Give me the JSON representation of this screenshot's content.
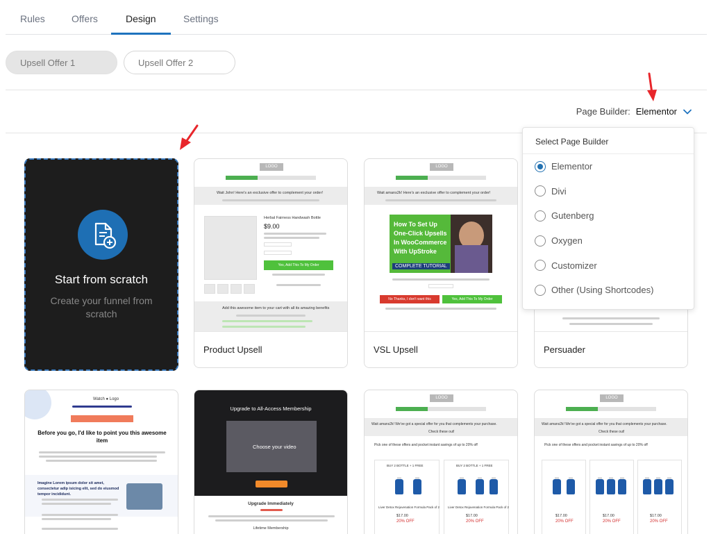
{
  "tabs": [
    {
      "label": "Rules"
    },
    {
      "label": "Offers"
    },
    {
      "label": "Design"
    },
    {
      "label": "Settings"
    }
  ],
  "offers": [
    {
      "label": "Upsell Offer 1"
    },
    {
      "label": "Upsell Offer 2"
    }
  ],
  "page_builder": {
    "label": "Page Builder:",
    "value": "Elementor"
  },
  "dropdown": {
    "header": "Select Page Builder",
    "options": [
      {
        "label": "Elementor",
        "checked": true
      },
      {
        "label": "Divi",
        "checked": false
      },
      {
        "label": "Gutenberg",
        "checked": false
      },
      {
        "label": "Oxygen",
        "checked": false
      },
      {
        "label": "Customizer",
        "checked": false
      },
      {
        "label": "Other (Using Shortcodes)",
        "checked": false
      }
    ]
  },
  "scratch": {
    "title": "Start from scratch",
    "subtitle": "Create your funnel from scratch"
  },
  "templates": [
    {
      "name": "Product Upsell"
    },
    {
      "name": "VSL Upsell"
    },
    {
      "name": "Persuader"
    }
  ],
  "thumbs": {
    "logo": "LOGO",
    "wait_john": "Wait John! Here's an exclusive offer to complement your order!",
    "wait_aman": "Wait amans2k! Here's an exclusive offer to complement your order!",
    "wait_aman2": "Wait amans2k! We've got a special offer for you that complements your purchase.",
    "vsl_title": "How To Set Up One-Click Upsells In WooCommerce With UpStroke",
    "vsl_tag": "COMPLETE TUTORIAL",
    "product_title": "Herbal Fairness Handwash Bottle",
    "product_price": "$9.00",
    "add_btn": "Yes, Add This To My Order",
    "no_btn": "No Thanks, I don't want this",
    "bundle_title": "Add this awesome item to your cart with all its amazing benefits",
    "before_title": "Before you go, I'd like to point you this awesome item",
    "before_sub": "Imagine Lorem ipsum dolor sit amet, consectetur adip isicing elit, sed do eiusmod tempor incididunt.",
    "membership_title": "Upgrade to All-Access Membership",
    "membership_btn": "Upgrade Now",
    "membership_sub": "Upgrade Immediately",
    "membership_foot": "Lifetime Membership",
    "video_text": "Choose your video",
    "check": "Check these out!",
    "pick": "Pick one of these offers and pocket instant savings of up to 20% off",
    "bundle_badge": "BUY 2 BOTTLE + 1 FREE",
    "price_red": "20% OFF",
    "price_val": "$17.00",
    "product_name": "Liver Detox Rejuvenation Formula Pack of 2"
  },
  "colors": {
    "accent": "#1e73be",
    "scratch_bg": "#1d1d1d",
    "icon_bg": "#1e6fb4",
    "arrow": "#e8262b"
  }
}
